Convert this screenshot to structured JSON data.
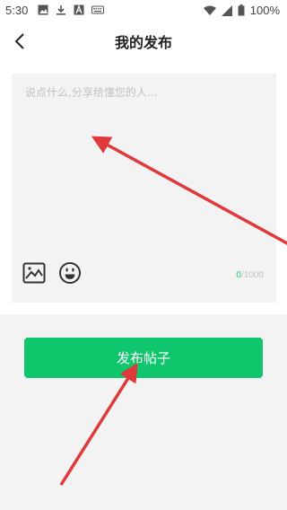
{
  "status_bar": {
    "time": "5:30",
    "battery_text": "100%",
    "icons": [
      "image-icon",
      "download-icon",
      "a-box-icon",
      "keyboard-icon",
      "wifi-icon",
      "signal-icon",
      "battery-icon"
    ]
  },
  "header": {
    "title": "我的发布",
    "back_icon": "chevron-left-icon"
  },
  "composer": {
    "placeholder": "说点什么,分享给懂您的人...",
    "value": "",
    "char_count": "0",
    "char_limit_suffix": "/1000",
    "tools": [
      "image-icon",
      "emoji-icon"
    ]
  },
  "actions": {
    "publish_label": "发布帖子"
  },
  "colors": {
    "accent": "#0fc66d",
    "counter_accent": "#22c773",
    "annotation_arrow": "#e0393b",
    "panel_bg": "#f3f3f3"
  }
}
